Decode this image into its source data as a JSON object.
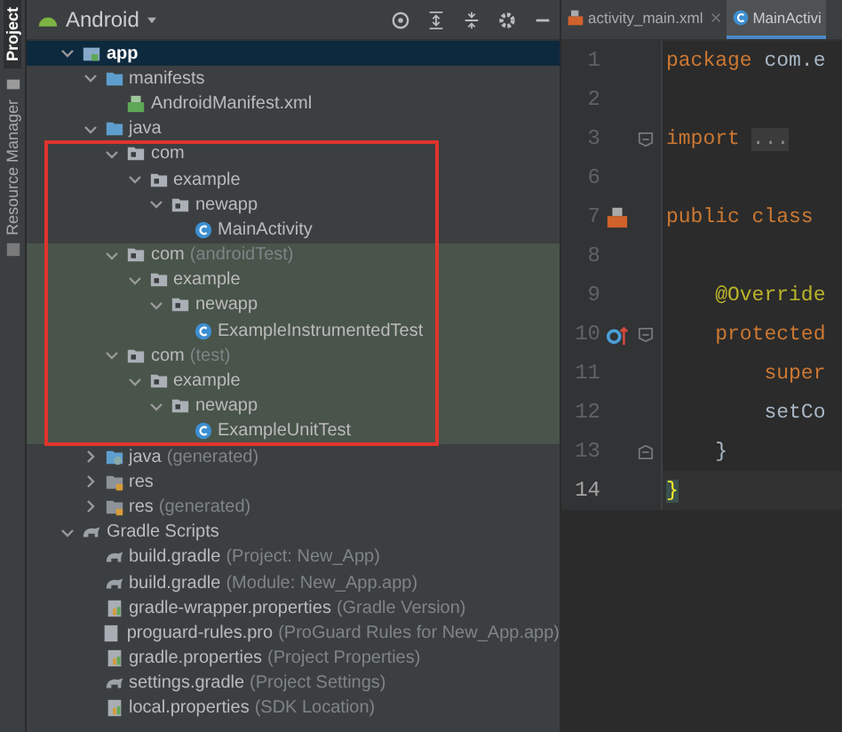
{
  "tool_strip": [
    {
      "label": "Project",
      "selected": true
    },
    {
      "label": "Resource Manager",
      "selected": false
    }
  ],
  "project_panel": {
    "view": "Android",
    "tree": [
      {
        "label": "app",
        "kind": "module",
        "expanded": true,
        "selected": true,
        "children": [
          {
            "label": "manifests",
            "kind": "folder",
            "expanded": true,
            "children": [
              {
                "label": "AndroidManifest.xml",
                "kind": "manifest"
              }
            ]
          },
          {
            "label": "java",
            "kind": "folder",
            "expanded": true,
            "outlined": true,
            "children": [
              {
                "label": "com",
                "kind": "package",
                "expanded": true,
                "children": [
                  {
                    "label": "example",
                    "kind": "package",
                    "expanded": true,
                    "children": [
                      {
                        "label": "newapp",
                        "kind": "package",
                        "expanded": true,
                        "children": [
                          {
                            "label": "MainActivity",
                            "kind": "class"
                          }
                        ]
                      }
                    ]
                  }
                ]
              },
              {
                "label": "com",
                "suffix": "(androidTest)",
                "kind": "package",
                "expanded": true,
                "highlighted": true,
                "children": [
                  {
                    "label": "example",
                    "kind": "package",
                    "expanded": true,
                    "children": [
                      {
                        "label": "newapp",
                        "kind": "package",
                        "expanded": true,
                        "children": [
                          {
                            "label": "ExampleInstrumentedTest",
                            "kind": "class"
                          }
                        ]
                      }
                    ]
                  }
                ]
              },
              {
                "label": "com",
                "suffix": "(test)",
                "kind": "package",
                "expanded": true,
                "highlighted": true,
                "children": [
                  {
                    "label": "example",
                    "kind": "package",
                    "expanded": true,
                    "children": [
                      {
                        "label": "newapp",
                        "kind": "package",
                        "expanded": true,
                        "children": [
                          {
                            "label": "ExampleUnitTest",
                            "kind": "class"
                          }
                        ]
                      }
                    ]
                  }
                ]
              }
            ]
          },
          {
            "label": "java",
            "suffix": "(generated)",
            "kind": "generated",
            "expanded": false
          },
          {
            "label": "res",
            "kind": "res",
            "expanded": false
          },
          {
            "label": "res",
            "suffix": "(generated)",
            "kind": "res",
            "expanded": false
          }
        ]
      },
      {
        "label": "Gradle Scripts",
        "kind": "gradle",
        "expanded": true,
        "children": [
          {
            "label": "build.gradle",
            "suffix": "(Project: New_App)",
            "kind": "gradle"
          },
          {
            "label": "build.gradle",
            "suffix": "(Module: New_App.app)",
            "kind": "gradle"
          },
          {
            "label": "gradle-wrapper.properties",
            "suffix": "(Gradle Version)",
            "kind": "properties"
          },
          {
            "label": "proguard-rules.pro",
            "suffix": "(ProGuard Rules for New_App.app)",
            "kind": "file"
          },
          {
            "label": "gradle.properties",
            "suffix": "(Project Properties)",
            "kind": "properties"
          },
          {
            "label": "settings.gradle",
            "suffix": "(Project Settings)",
            "kind": "gradle"
          },
          {
            "label": "local.properties",
            "suffix": "(SDK Location)",
            "kind": "properties"
          }
        ]
      }
    ]
  },
  "editor": {
    "tabs": [
      {
        "label": "activity_main.xml",
        "kind": "xml",
        "selected": false
      },
      {
        "label": "MainActivi",
        "kind": "class",
        "selected": true
      }
    ],
    "lines": [
      {
        "number": "1",
        "tokens": [
          {
            "text": "package",
            "kind": "keyword"
          },
          {
            "text": " com.e",
            "kind": "plain"
          }
        ]
      },
      {
        "number": "2"
      },
      {
        "number": "3",
        "fold": {
          "kind": "start"
        },
        "tokens": [
          {
            "text": "import",
            "kind": "keyword"
          },
          {
            "text": "...",
            "kind": "folded"
          }
        ]
      },
      {
        "number": "6"
      },
      {
        "number": "7",
        "marker": {
          "kind": "layout"
        },
        "tokens": [
          {
            "text": "public class",
            "kind": "keyword"
          }
        ]
      },
      {
        "number": "8"
      },
      {
        "number": "9",
        "tokens": [
          {
            "text": "    @Override",
            "kind": "annotation"
          }
        ]
      },
      {
        "number": "10",
        "marker": {
          "kind": "override"
        },
        "fold": {
          "kind": "start"
        },
        "tokens": [
          {
            "text": "    protected",
            "kind": "keyword"
          }
        ]
      },
      {
        "number": "11",
        "tokens": [
          {
            "text": "        super",
            "kind": "keyword"
          }
        ]
      },
      {
        "number": "12",
        "tokens": [
          {
            "text": "        setCo",
            "kind": "plain"
          }
        ]
      },
      {
        "number": "13",
        "fold": {
          "kind": "end"
        },
        "tokens": [
          {
            "text": "    }",
            "kind": "plain"
          }
        ]
      },
      {
        "number": "14",
        "current": true,
        "tokens": [
          {
            "text": "}",
            "kind": "brace"
          }
        ]
      }
    ]
  }
}
